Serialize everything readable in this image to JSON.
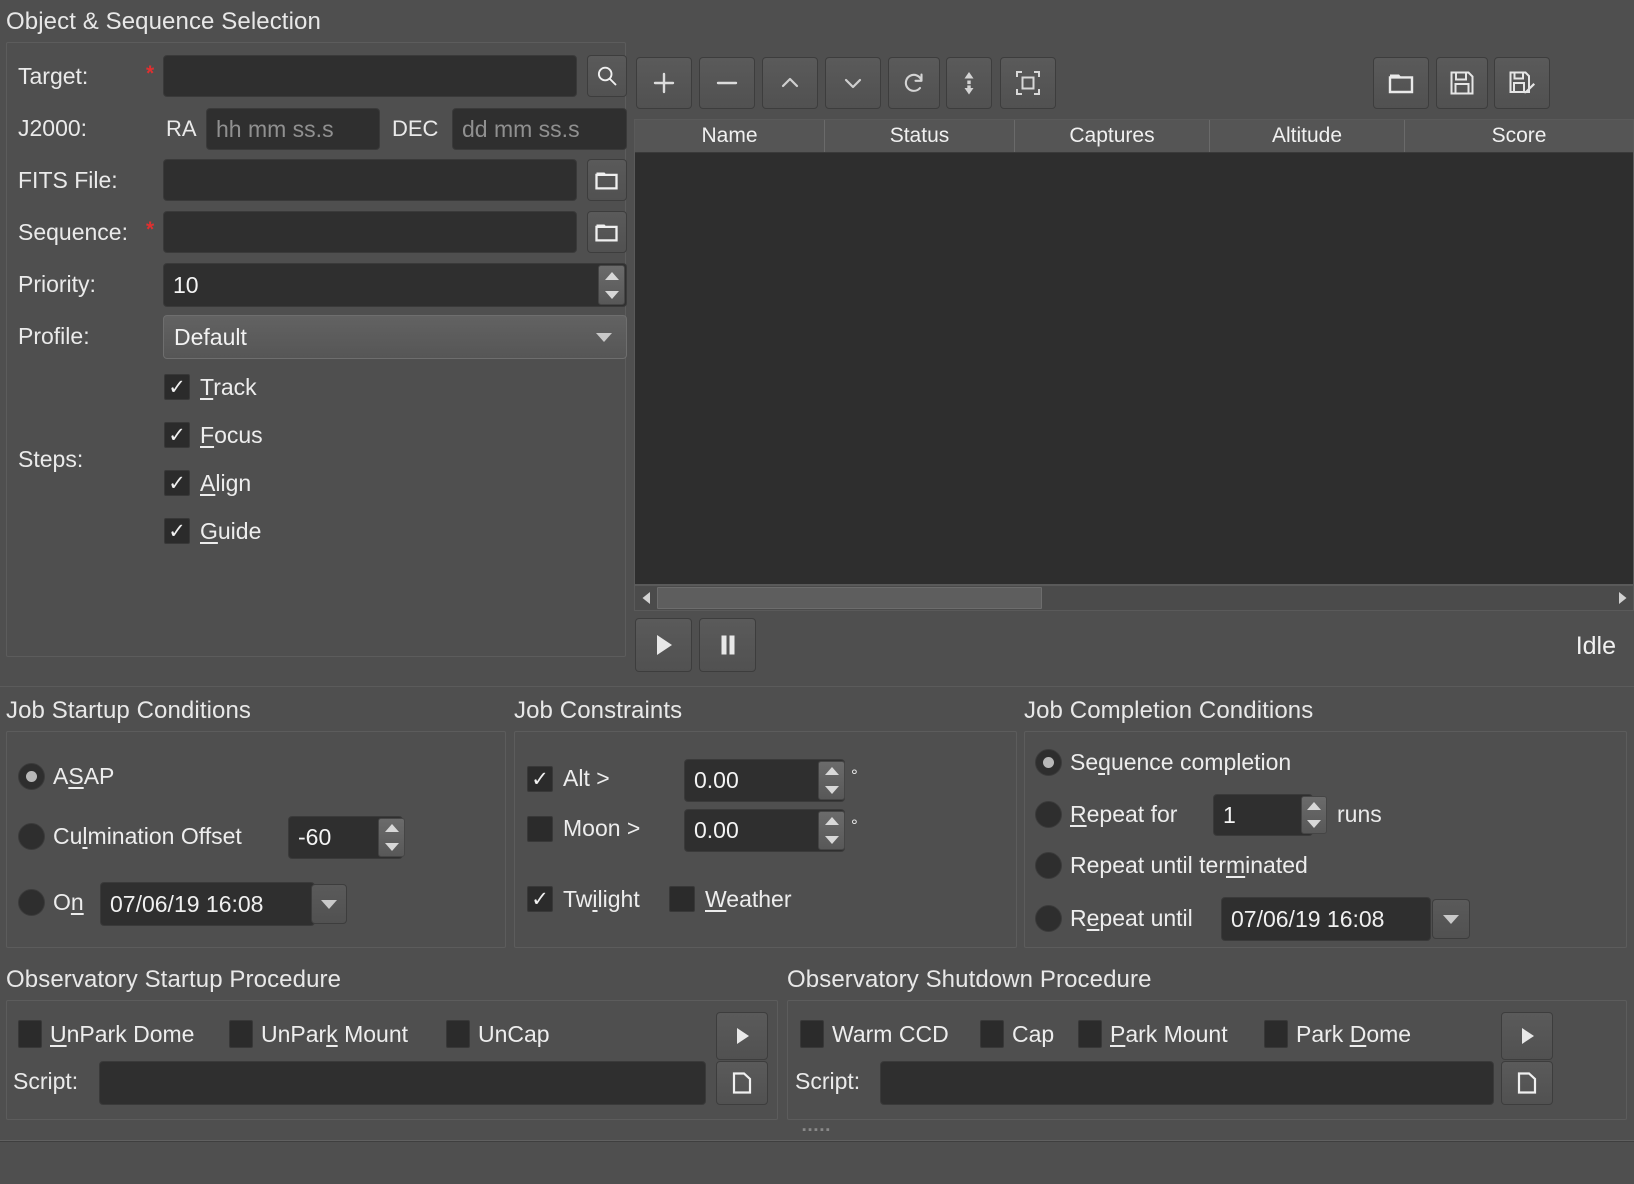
{
  "sections": {
    "object_sequence": "Object & Sequence Selection",
    "job_startup": "Job Startup Conditions",
    "job_constraints": "Job Constraints",
    "job_completion": "Job Completion Conditions",
    "obs_startup": "Observatory Startup Procedure",
    "obs_shutdown": "Observatory Shutdown Procedure"
  },
  "object_form": {
    "target_label": "Target:",
    "target_required": "*",
    "target_value": "",
    "j2000_label": "J2000:",
    "ra_label": "RA",
    "ra_placeholder": "hh mm ss.s",
    "ra_value": "",
    "dec_label": "DEC",
    "dec_placeholder": "dd mm ss.s",
    "dec_value": "",
    "fits_label": "FITS File:",
    "fits_value": "",
    "sequence_label": "Sequence:",
    "sequence_required": "*",
    "sequence_value": "",
    "priority_label": "Priority:",
    "priority_value": "10",
    "profile_label": "Profile:",
    "profile_value": "Default",
    "steps_label": "Steps:",
    "steps": [
      {
        "label": "Track",
        "mnemonic": "T",
        "checked": true
      },
      {
        "label": "Focus",
        "mnemonic": "F",
        "checked": true
      },
      {
        "label": "Align",
        "mnemonic": "A",
        "checked": true
      },
      {
        "label": "Guide",
        "mnemonic": "G",
        "checked": true
      }
    ]
  },
  "job_toolbar": {
    "add": "add-job",
    "remove": "remove-job",
    "up": "move-job-up",
    "down": "move-job-down",
    "reset": "reset-job",
    "sort": "sort-jobs",
    "evaluate": "evaluate-jobs",
    "open": "open-schedule",
    "save": "save-schedule",
    "save_as": "save-schedule-as"
  },
  "job_table": {
    "columns": [
      "Name",
      "Status",
      "Captures",
      "Altitude",
      "Score"
    ],
    "rows": []
  },
  "scheduler_controls": {
    "start_label": "start-scheduler",
    "pause_label": "pause-scheduler",
    "status": "Idle"
  },
  "startup_conditions": {
    "asap": {
      "label": "ASAP",
      "mnemonic": "S",
      "selected": true
    },
    "culmination": {
      "label": "Culmination Offset",
      "mnemonic": "l",
      "selected": false,
      "value": "-60"
    },
    "on": {
      "label": "On",
      "mnemonic": "n",
      "selected": false,
      "value": "07/06/19 16:08"
    }
  },
  "constraints": {
    "alt": {
      "label": "Alt >",
      "checked": true,
      "value": "0.00",
      "unit": "°"
    },
    "moon": {
      "label": "Moon  >",
      "checked": false,
      "value": "0.00",
      "unit": "°"
    },
    "twilight": {
      "label": "Twilight",
      "mnemonic": "i",
      "checked": true
    },
    "weather": {
      "label": "Weather",
      "mnemonic": "W",
      "checked": false
    }
  },
  "completion_conditions": {
    "sequence": {
      "label": "Sequence completion",
      "mnemonic": "q",
      "selected": true
    },
    "repeat_for": {
      "label": "Repeat for",
      "mnemonic": "R",
      "selected": false,
      "value": "1",
      "suffix": "runs"
    },
    "repeat_terminated": {
      "label": "Repeat until terminated",
      "mnemonic": "m",
      "selected": false
    },
    "repeat_until": {
      "label": "Repeat until",
      "mnemonic": "e",
      "selected": false,
      "value": "07/06/19 16:08"
    }
  },
  "observatory_startup": {
    "items": [
      {
        "label": "UnPark Dome",
        "mnemonic": "U",
        "checked": false
      },
      {
        "label": "UnPark Mount",
        "mnemonic": "k",
        "checked": false
      },
      {
        "label": "UnCap",
        "mnemonic": "",
        "checked": false
      }
    ],
    "script_label": "Script:",
    "script_value": "",
    "run_label": "run-startup-procedure",
    "browse_label": "browse-startup-script"
  },
  "observatory_shutdown": {
    "items": [
      {
        "label": "Warm CCD",
        "mnemonic": "",
        "checked": false
      },
      {
        "label": "Cap",
        "mnemonic": "",
        "checked": false
      },
      {
        "label": "Park Mount",
        "mnemonic": "P",
        "checked": false
      },
      {
        "label": "Park Dome",
        "mnemonic": "D",
        "checked": false
      }
    ],
    "script_label": "Script:",
    "script_value": "",
    "run_label": "run-shutdown-procedure",
    "browse_label": "browse-shutdown-script"
  },
  "colors": {
    "window_bg": "#4f4f4f",
    "field_bg": "#2f2f2f",
    "table_bg": "#2e2e2e",
    "header_bg": "#555555",
    "text": "#ededed",
    "required": "#e03030"
  }
}
